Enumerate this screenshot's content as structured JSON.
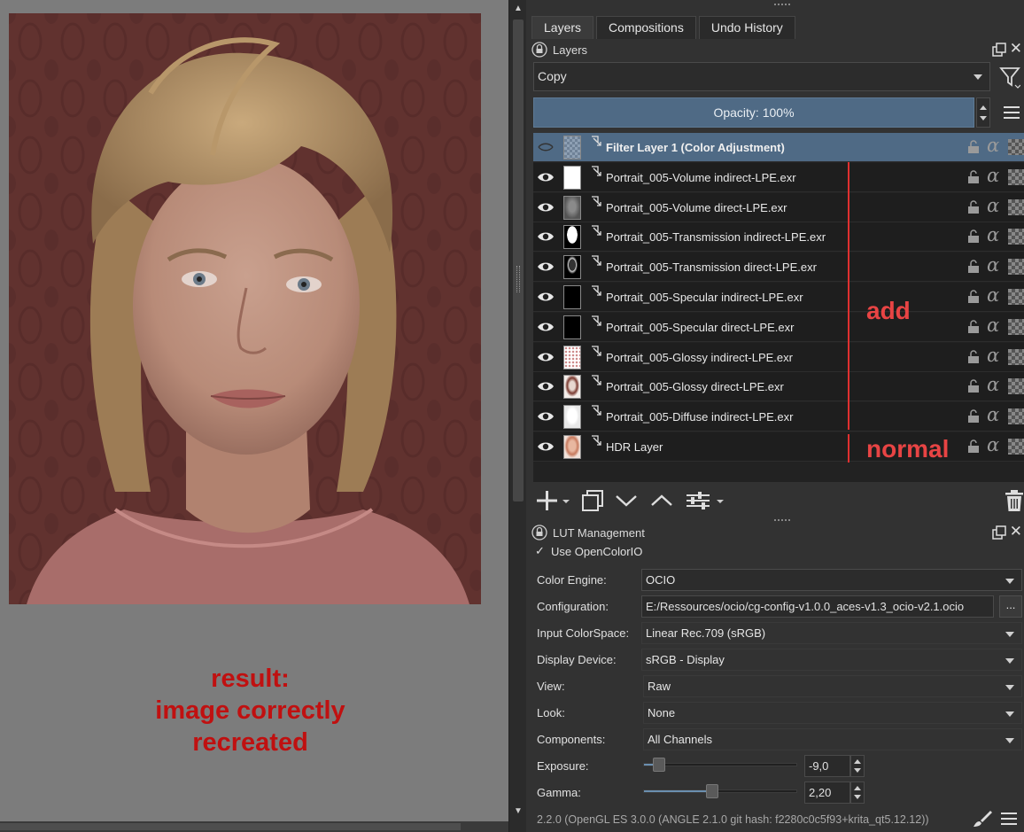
{
  "canvas": {
    "annotation_lines": [
      "result:",
      "image correctly",
      "recreated"
    ]
  },
  "colors": {
    "panel_bg": "#323232",
    "selection": "#4f6a85",
    "annotation_red": "#e03030",
    "result_text_red": "#c01010"
  },
  "docker": {
    "tabs": [
      {
        "label": "Layers",
        "active": true
      },
      {
        "label": "Compositions",
        "active": false
      },
      {
        "label": "Undo History",
        "active": false
      }
    ],
    "layers_title": "Layers",
    "blend_mode": "Copy",
    "opacity_label": "Opacity:  100%",
    "opacity_value": 100,
    "layers": [
      {
        "name": "Filter Layer 1 (Color Adjustment)",
        "selected": true,
        "visible": false,
        "thumb": "checker"
      },
      {
        "name": "Portrait_005-Volume indirect-LPE.exr",
        "selected": false,
        "visible": true,
        "thumb": "white"
      },
      {
        "name": "Portrait_005-Volume direct-LPE.exr",
        "selected": false,
        "visible": true,
        "thumb": "grey"
      },
      {
        "name": "Portrait_005-Transmission indirect-LPE.exr",
        "selected": false,
        "visible": true,
        "thumb": "silhouette-white"
      },
      {
        "name": "Portrait_005-Transmission direct-LPE.exr",
        "selected": false,
        "visible": true,
        "thumb": "silhouette-dark"
      },
      {
        "name": "Portrait_005-Specular indirect-LPE.exr",
        "selected": false,
        "visible": true,
        "thumb": "black"
      },
      {
        "name": "Portrait_005-Specular direct-LPE.exr",
        "selected": false,
        "visible": true,
        "thumb": "black"
      },
      {
        "name": "Portrait_005-Glossy indirect-LPE.exr",
        "selected": false,
        "visible": true,
        "thumb": "speckle"
      },
      {
        "name": "Portrait_005-Glossy direct-LPE.exr",
        "selected": false,
        "visible": true,
        "thumb": "face-sketch"
      },
      {
        "name": "Portrait_005-Diffuse indirect-LPE.exr",
        "selected": false,
        "visible": true,
        "thumb": "face-light"
      },
      {
        "name": "HDR Layer",
        "selected": false,
        "visible": true,
        "thumb": "face-color"
      }
    ],
    "annotation_add": "add",
    "annotation_normal": "normal"
  },
  "lut": {
    "title": "LUT Management",
    "use_ocio_label": "Use OpenColorIO",
    "use_ocio_checked": true,
    "check_glyph": "✓",
    "browse_label": "...",
    "rows": {
      "color_engine": {
        "label": "Color Engine:",
        "value": "OCIO"
      },
      "configuration": {
        "label": "Configuration:",
        "value": "E:/Ressources/ocio/cg-config-v1.0.0_aces-v1.3_ocio-v2.1.ocio"
      },
      "input_colorspace": {
        "label": "Input ColorSpace:",
        "value": "Linear Rec.709 (sRGB)"
      },
      "display_device": {
        "label": "Display Device:",
        "value": "sRGB - Display"
      },
      "view": {
        "label": "View:",
        "value": "Raw"
      },
      "look": {
        "label": "Look:",
        "value": "None"
      },
      "components": {
        "label": "Components:",
        "value": "All Channels"
      },
      "exposure": {
        "label": "Exposure:",
        "value": "-9,0",
        "fraction": 0.06
      },
      "gamma": {
        "label": "Gamma:",
        "value": "2,20",
        "fraction": 0.44
      }
    },
    "status": "2.2.0 (OpenGL ES 3.0.0 (ANGLE 2.1.0 git hash: f2280c0c5f93+krita_qt5.12.12))"
  }
}
